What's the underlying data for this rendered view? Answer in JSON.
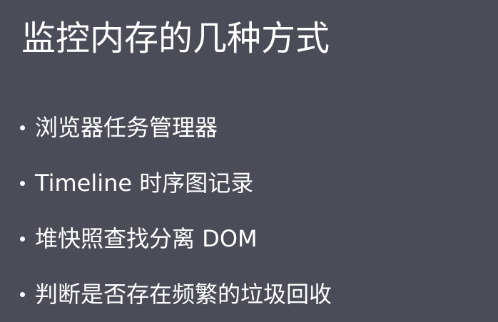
{
  "slide": {
    "title": "监控内存的几种方式",
    "bullets": [
      "浏览器任务管理器",
      "Timeline 时序图记录",
      "堆快照查找分离 DOM",
      "判断是否存在频繁的垃圾回收"
    ]
  },
  "colors": {
    "background": "#4a4c58",
    "text": "#ffffff"
  }
}
